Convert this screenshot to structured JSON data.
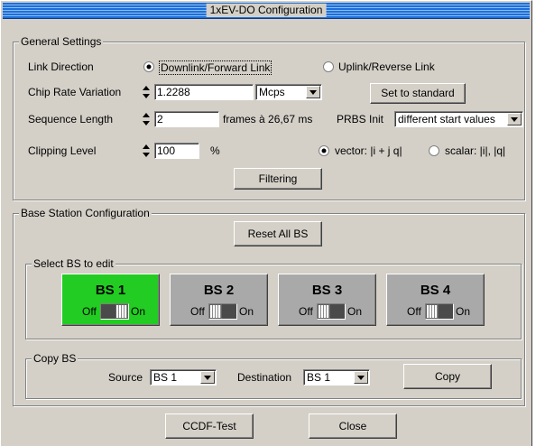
{
  "window": {
    "title": "1xEV-DO Configuration"
  },
  "general": {
    "group_label": "General Settings",
    "link_direction": {
      "label": "Link Direction",
      "option_down": "Downlink/Forward Link",
      "option_up": "Uplink/Reverse Link",
      "selected": "down"
    },
    "chip_rate": {
      "label": "Chip Rate Variation",
      "value": "1.2288",
      "unit": "Mcps",
      "set_standard": "Set to standard"
    },
    "sequence": {
      "label": "Sequence Length",
      "value": "2",
      "suffix": "frames à 26,67 ms",
      "prbs_label": "PRBS Init",
      "prbs_value": "different start values"
    },
    "clipping": {
      "label": "Clipping Level",
      "value": "100",
      "unit": "%",
      "vector_label": "vector: |i + j q|",
      "scalar_label": "scalar: |i|, |q|",
      "selected": "vector"
    },
    "filtering_label": "Filtering"
  },
  "base_station": {
    "group_label": "Base Station Configuration",
    "reset_label": "Reset All BS",
    "select_label": "Select BS to edit",
    "off_label": "Off",
    "on_label": "On",
    "tiles": [
      {
        "name": "BS 1",
        "active": true
      },
      {
        "name": "BS 2",
        "active": false
      },
      {
        "name": "BS 3",
        "active": false
      },
      {
        "name": "BS 4",
        "active": false
      }
    ],
    "copy": {
      "group_label": "Copy BS",
      "source_label": "Source",
      "source_value": "BS 1",
      "dest_label": "Destination",
      "dest_value": "BS 1",
      "copy_button": "Copy"
    }
  },
  "footer": {
    "ccdf_label": "CCDF-Test",
    "close_label": "Close"
  },
  "colors": {
    "title_bar": "#1d6fd9",
    "active_tile": "#22cc22",
    "inactive_tile": "#a9a9a9",
    "window_bg": "#d4d0c8"
  }
}
